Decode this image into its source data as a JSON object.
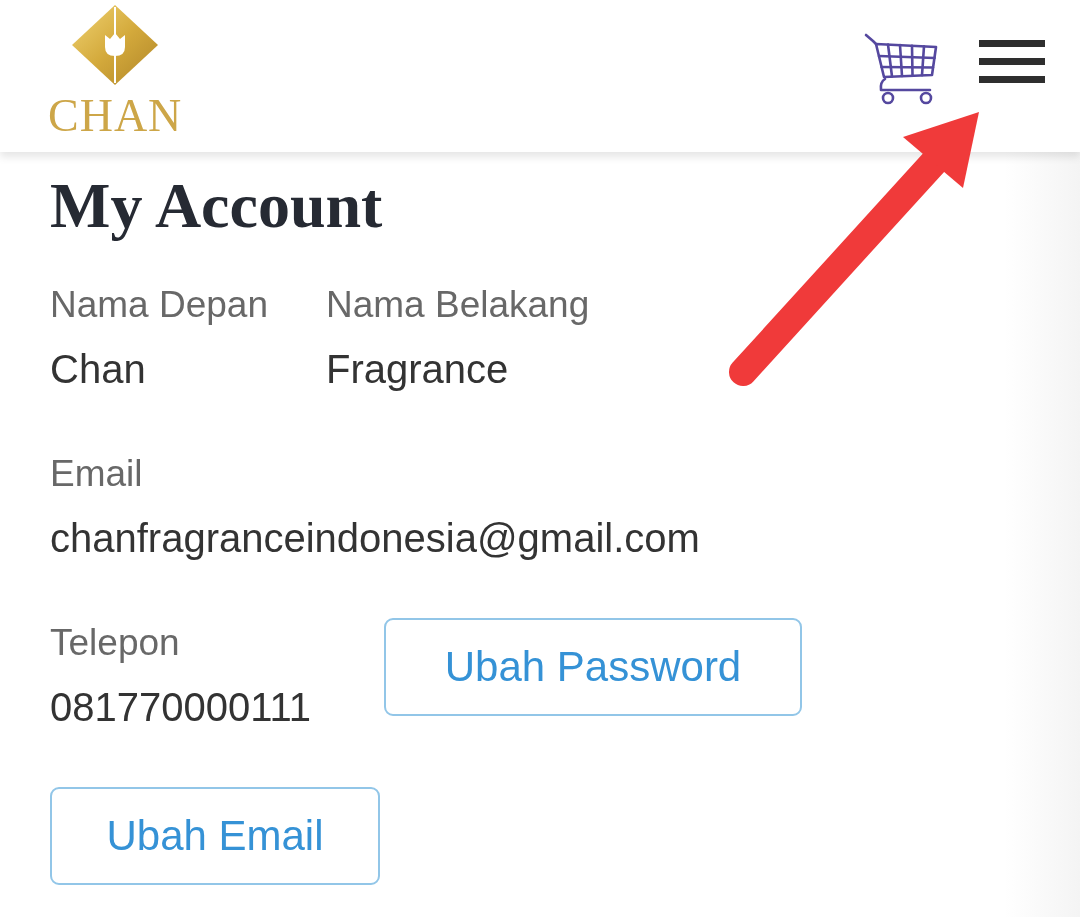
{
  "header": {
    "brand": "CHAN"
  },
  "title": "My Account",
  "name_fields": [
    {
      "label": "Nama Depan",
      "value": "Chan"
    },
    {
      "label": "Nama Belakang",
      "value": "Fragrance"
    }
  ],
  "email_field": {
    "label": "Email",
    "value": "chanfragranceindonesia@gmail.com"
  },
  "phone_field": {
    "label": "Telepon",
    "value": "081770000111"
  },
  "buttons": [
    {
      "label": "Ubah Password"
    },
    {
      "label": "Ubah Email"
    }
  ]
}
